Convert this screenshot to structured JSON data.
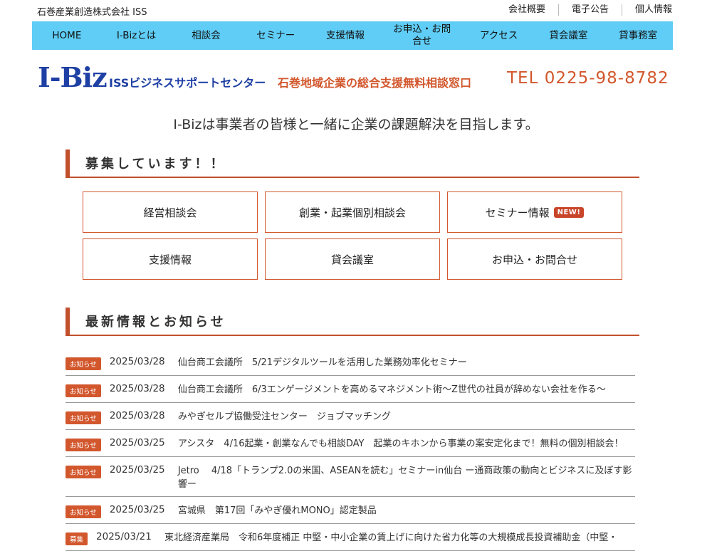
{
  "header": {
    "company": "石巻産業創造株式会社 ISS",
    "links": [
      "会社概要",
      "電子公告",
      "個人情報"
    ]
  },
  "nav": [
    "HOME",
    "I-Bizとは",
    "相談会",
    "セミナー",
    "支援情報",
    "お申込・お問合せ",
    "アクセス",
    "貸会議室",
    "貸事務室"
  ],
  "logo": {
    "main": "I-Biz",
    "sub": "ISSビジネスサポートセンター",
    "tagline": "石巻地域企業の総合支援無料相談窓口",
    "tel": "TEL 0225-98-8782"
  },
  "tagline": "I-Bizは事業者の皆様と一緒に企業の課題解決を目指します。",
  "recruit": {
    "title": "募集しています！！",
    "cards": [
      {
        "label": "経営相談会"
      },
      {
        "label": "創業・起業個別相談会"
      },
      {
        "label": "セミナー情報",
        "badge": "NEW!"
      },
      {
        "label": "支援情報"
      },
      {
        "label": "貸会議室"
      },
      {
        "label": "お申込・お問合せ"
      }
    ]
  },
  "news": {
    "title": "最新情報とお知らせ",
    "items": [
      {
        "tag": "お知らせ",
        "date": "2025/03/28",
        "text": "仙台商工会議所　5/21デジタルツールを活用した業務効率化セミナー"
      },
      {
        "tag": "お知らせ",
        "date": "2025/03/28",
        "text": "仙台商工会議所　6/3エンゲージメントを高めるマネジメント術〜Z世代の社員が辞めない会社を作る〜"
      },
      {
        "tag": "お知らせ",
        "date": "2025/03/28",
        "text": "みやぎセルプ協働受注センター　ジョブマッチング"
      },
      {
        "tag": "お知らせ",
        "date": "2025/03/25",
        "text": "アシスタ　4/16起業・創業なんでも相談DAY　起業のキホンから事業の案安定化まで！無料の個別相談会！"
      },
      {
        "tag": "お知らせ",
        "date": "2025/03/25",
        "text": "Jetro　 4/18「トランプ2.0の米国、ASEANを読む」セミナーin仙台 ー通商政策の動向とビジネスに及ぼす影響ー"
      },
      {
        "tag": "お知らせ",
        "date": "2025/03/25",
        "text": "宮城県　第17回「みやぎ優れMONO」認定製品"
      },
      {
        "tag": "募集",
        "date": "2025/03/21",
        "text": "東北経済産業局　令和6年度補正 中堅・中小企業の賃上げに向けた省力化等の大規模成長投資補助金（中堅・"
      }
    ]
  },
  "colors": {
    "nav_bg": "#5fcdf6",
    "accent": "#d2572d",
    "logo_blue": "#1e3fa3"
  }
}
